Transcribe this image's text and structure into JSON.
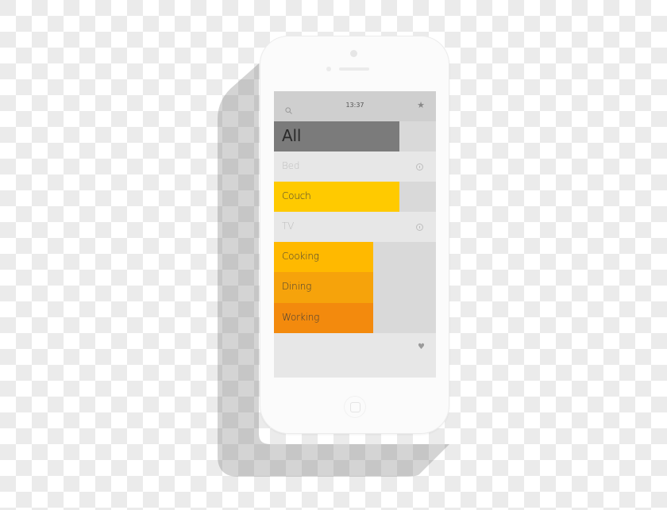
{
  "device": {
    "type": "smartphone-mockup",
    "frame_color": "#fbfbfb"
  },
  "statusbar": {
    "time": "13:37",
    "left_icon": "search-icon",
    "right_icon": "star-icon"
  },
  "rows": [
    {
      "label": "All",
      "type": "category",
      "fill_color": "#7b7b7b",
      "fill_fraction": 0.77
    },
    {
      "label": "Bed",
      "type": "inactive",
      "icon": "info-icon"
    },
    {
      "label": "Couch",
      "type": "category",
      "fill_color": "#ffca00",
      "fill_fraction": 0.77
    },
    {
      "label": "TV",
      "type": "inactive",
      "icon": "info-icon"
    },
    {
      "label": "Cooking",
      "type": "category",
      "fill_color": "#ffb900",
      "fill_fraction": 0.61
    },
    {
      "label": "Dining",
      "type": "category",
      "fill_color": "#f6a30b",
      "fill_fraction": 0.61
    },
    {
      "label": "Working",
      "type": "category",
      "fill_color": "#f38a0d",
      "fill_fraction": 0.61
    }
  ],
  "footer": {
    "icon": "heart-icon"
  },
  "colors": {
    "statusbar_bg": "#cfcfcf",
    "row_bg": "#e7e7e7",
    "track_bg": "#d9d9d9",
    "muted_text": "#bdbdbd"
  }
}
